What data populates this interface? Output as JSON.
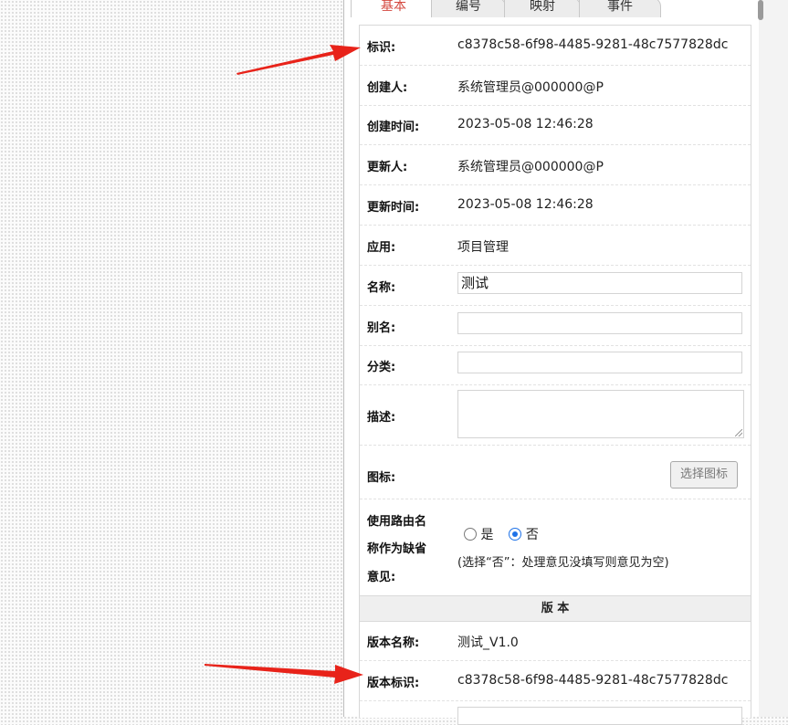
{
  "tabs": [
    {
      "label": "基本"
    },
    {
      "label": "编号"
    },
    {
      "label": "映射"
    },
    {
      "label": "事件"
    }
  ],
  "fields": {
    "id": {
      "label": "标识:",
      "value": "c8378c58-6f98-4485-9281-48c7577828dc"
    },
    "creator": {
      "label": "创建人:",
      "value": "系统管理员@000000@P"
    },
    "created_time": {
      "label": "创建时间:",
      "value": "2023-05-08 12:46:28"
    },
    "updater": {
      "label": "更新人:",
      "value": "系统管理员@000000@P"
    },
    "updated_time": {
      "label": "更新时间:",
      "value": "2023-05-08 12:46:28"
    },
    "app": {
      "label": "应用:",
      "value": "项目管理"
    },
    "name": {
      "label": "名称:",
      "value": "测试"
    },
    "alias": {
      "label": "别名:",
      "value": ""
    },
    "category": {
      "label": "分类:",
      "value": ""
    },
    "description": {
      "label": "描述:",
      "value": ""
    },
    "icon": {
      "label": "图标:",
      "button": "选择图标"
    },
    "route_default": {
      "label_line1": "使用路由名",
      "label_line2": "称作为缺省",
      "label_line3": "意见:",
      "option_yes": "是",
      "option_no": "否",
      "selected": "否",
      "hint": "(选择“否”：处理意见没填写则意见为空)"
    }
  },
  "version_section": {
    "title": "版 本",
    "name": {
      "label": "版本名称:",
      "value": "测试_V1.0"
    },
    "id": {
      "label": "版本标识:",
      "value": "c8378c58-6f98-4485-9281-48c7577828dc"
    }
  },
  "colors": {
    "active_tab": "#d4473e",
    "radio_accent": "#1e72e8",
    "annotation_arrow": "#e8231a"
  }
}
